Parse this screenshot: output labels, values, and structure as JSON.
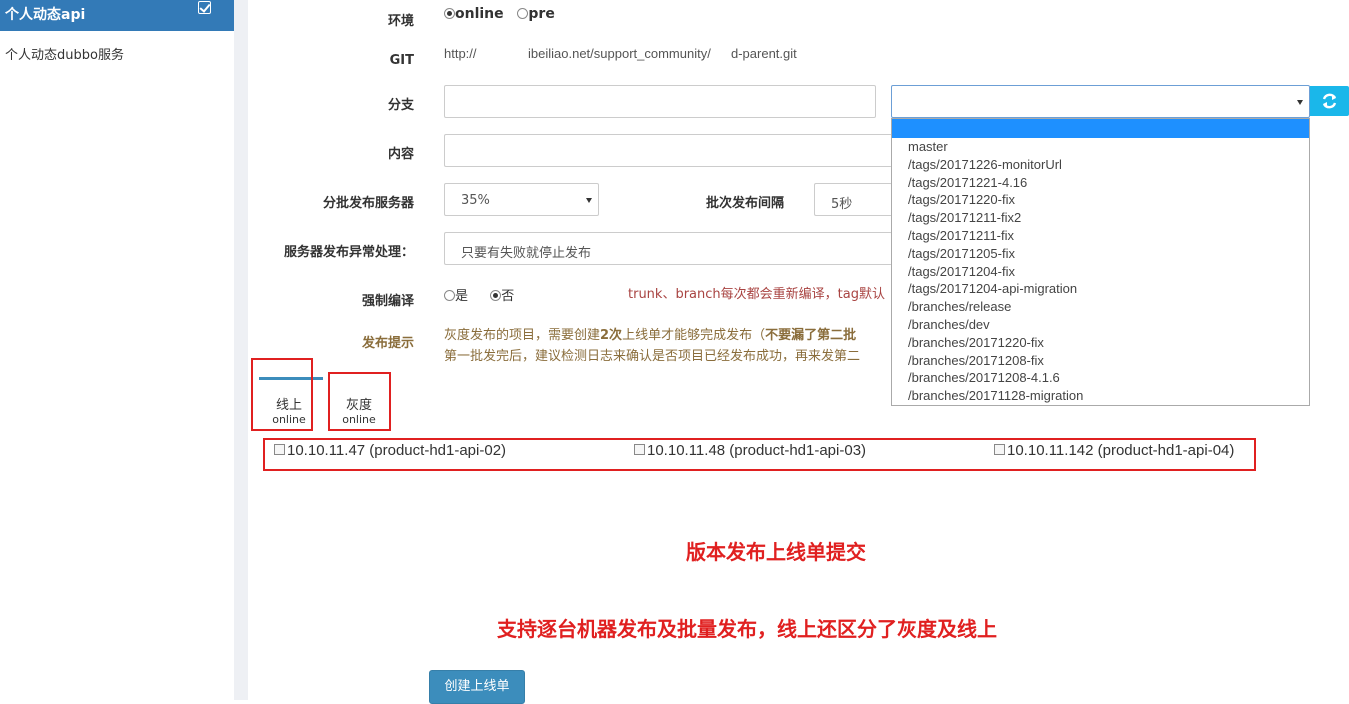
{
  "sidebar": {
    "title": "个人动态api",
    "item": "个人动态dubbo服务"
  },
  "form": {
    "env_label": "环境",
    "env_options": [
      "online",
      "pre"
    ],
    "git_label": "GIT",
    "git_url_a": "http://",
    "git_url_b": "ibeiliao.net/support_community/",
    "git_url_c": "d-parent.git",
    "branch_label": "分支",
    "branch_input_value": "",
    "branch_select_value": "",
    "content_label": "内容",
    "content_value": "",
    "batch_label": "分批发布服务器",
    "batch_value": "35%",
    "interval_label": "批次发布间隔",
    "interval_value": "5秒",
    "error_label": "服务器发布异常处理：",
    "error_value": "只要有失败就停止发布",
    "force_label": "强制编译",
    "force_options": [
      "是",
      "否"
    ],
    "force_note": "trunk、branch每次都会重新编译，tag默认",
    "tip_label": "发布提示",
    "tip_line1_a": "灰度发布的项目，需要创建",
    "tip_line1_b": "2次",
    "tip_line1_c": "上线单才能够完成发布（",
    "tip_line1_d": "不要漏了第二批",
    "tip_line2": "第一批发完后，建议检测日志来确认是否项目已经发布成功，再来发第二"
  },
  "branch_options": [
    "master",
    "/tags/20171226-monitorUrl",
    "/tags/20171221-4.16",
    "/tags/20171220-fix",
    "/tags/20171211-fix2",
    "/tags/20171211-fix",
    "/tags/20171205-fix",
    "/tags/20171204-fix",
    "/tags/20171204-api-migration",
    "/branches/release",
    "/branches/dev",
    "/branches/20171220-fix",
    "/branches/20171208-fix",
    "/branches/20171208-4.1.6",
    "/branches/20171128-migration"
  ],
  "tabs": [
    {
      "label": "线上",
      "sub": "online"
    },
    {
      "label": "灰度",
      "sub": "online"
    }
  ],
  "servers": [
    "10.10.11.47 (product-hd1-api-02)",
    "10.10.11.48 (product-hd1-api-03)",
    "10.10.11.142 (product-hd1-api-04)"
  ],
  "annotations": {
    "line1": "版本发布上线单提交",
    "line2": "支持逐台机器发布及批量发布，线上还区分了灰度及线上"
  },
  "create_button": "创建上线单",
  "colors": {
    "accent": "#337ab7",
    "annotation_red": "#e02020",
    "tip_brown": "#8a6d3b",
    "refresh": "#1ab7ea",
    "highlight": "#1e90ff"
  }
}
